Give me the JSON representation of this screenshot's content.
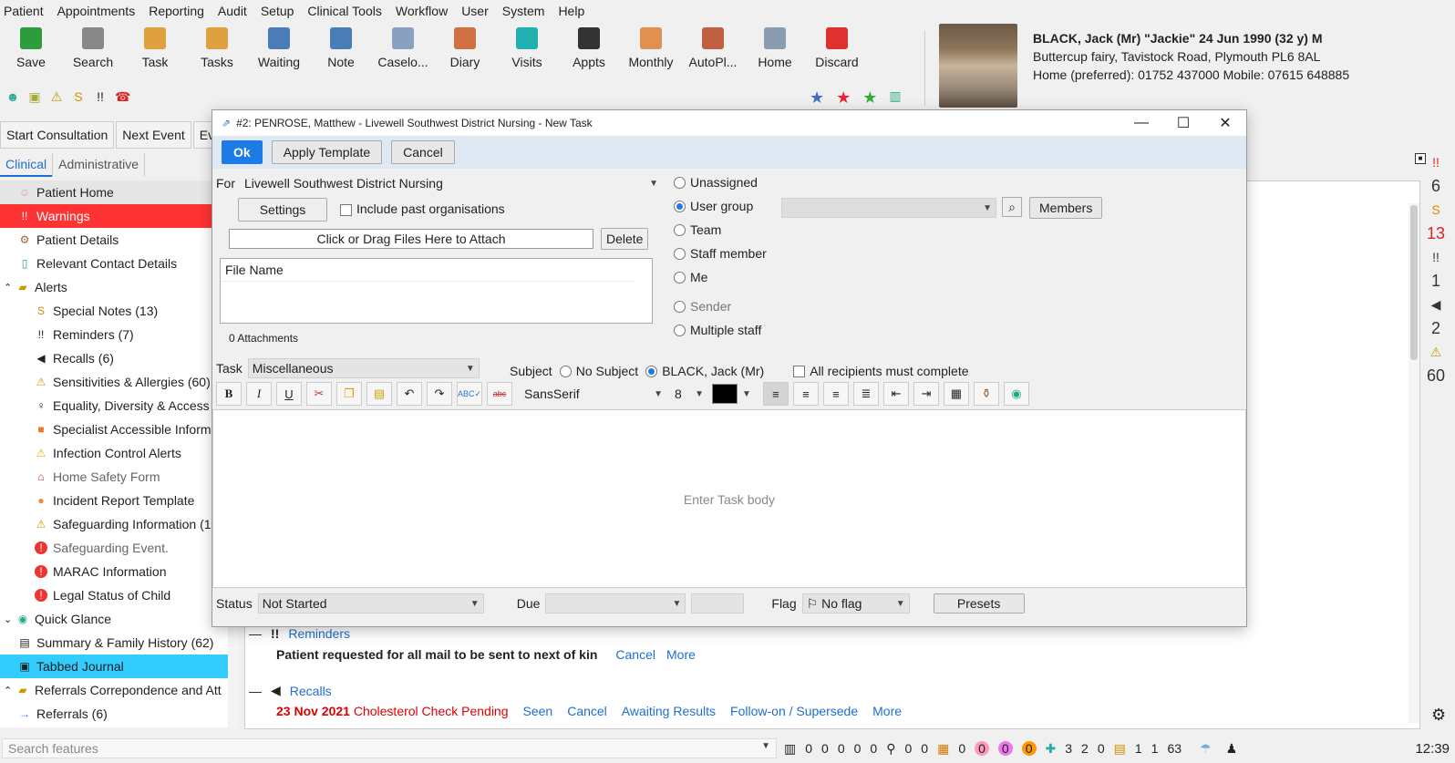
{
  "menu": [
    "Patient",
    "Appointments",
    "Reporting",
    "Audit",
    "Setup",
    "Clinical Tools",
    "Workflow",
    "User",
    "System",
    "Help"
  ],
  "toolbar": [
    {
      "label": "Save",
      "icon": "save-icon",
      "color": "#2e9b3c"
    },
    {
      "label": "Search",
      "icon": "search-icon",
      "color": "#888"
    },
    {
      "label": "Task",
      "icon": "task-icon",
      "color": "#e0a040"
    },
    {
      "label": "Tasks",
      "icon": "tasks-icon",
      "color": "#e0a040"
    },
    {
      "label": "Waiting",
      "icon": "waiting-icon",
      "color": "#4a7db8"
    },
    {
      "label": "Note",
      "icon": "note-icon",
      "color": "#4a7db8"
    },
    {
      "label": "Caselo...",
      "icon": "caseload-icon",
      "color": "#8aa0c0"
    },
    {
      "label": "Diary",
      "icon": "diary-icon",
      "color": "#d07040"
    },
    {
      "label": "Visits",
      "icon": "visits-icon",
      "color": "#20b0b0"
    },
    {
      "label": "Appts",
      "icon": "appts-icon",
      "color": "#333"
    },
    {
      "label": "Monthly",
      "icon": "monthly-icon",
      "color": "#e09050"
    },
    {
      "label": "AutoPl...",
      "icon": "autoplan-icon",
      "color": "#c06040"
    },
    {
      "label": "Home",
      "icon": "home-icon",
      "color": "#8a9cb0"
    },
    {
      "label": "Discard",
      "icon": "discard-icon",
      "color": "#e03030"
    }
  ],
  "patient": {
    "name": "BLACK, Jack (Mr) \"Jackie\" 24 Jun 1990 (32 y) M",
    "address": "Buttercup fairy, Tavistock Road, Plymouth PL6 8AL",
    "phone": "Home (preferred): 01752 437000 Mobile: 07615 648885"
  },
  "consult": [
    "Start Consultation",
    "Next Event",
    "Ev"
  ],
  "tabs": [
    "Clinical",
    "Administrative"
  ],
  "sidebar": [
    {
      "label": "Patient Home",
      "indent": 1,
      "icon": "person-icon",
      "style": "hl"
    },
    {
      "label": "Warnings",
      "indent": 1,
      "icon": "warning-icon",
      "style": "warn"
    },
    {
      "label": "Patient Details",
      "indent": 1,
      "icon": "details-icon",
      "style": ""
    },
    {
      "label": "Relevant Contact Details",
      "indent": 1,
      "icon": "contact-icon",
      "style": ""
    },
    {
      "label": "Alerts",
      "indent": 0,
      "icon": "folder-icon",
      "style": "",
      "toggle": "^"
    },
    {
      "label": "Special Notes (13)",
      "indent": 2,
      "icon": "special-notes-icon",
      "style": ""
    },
    {
      "label": "Reminders (7)",
      "indent": 2,
      "icon": "reminder-icon",
      "style": ""
    },
    {
      "label": "Recalls (6)",
      "indent": 2,
      "icon": "recall-icon",
      "style": ""
    },
    {
      "label": "Sensitivities & Allergies (60)",
      "indent": 2,
      "icon": "allergy-icon",
      "style": ""
    },
    {
      "label": "Equality, Diversity & Access",
      "indent": 2,
      "icon": "equality-icon",
      "style": ""
    },
    {
      "label": "Specialist Accessible Inform",
      "indent": 2,
      "icon": "accessible-icon",
      "style": ""
    },
    {
      "label": "Infection Control Alerts",
      "indent": 2,
      "icon": "infection-icon",
      "style": ""
    },
    {
      "label": "Home Safety Form",
      "indent": 2,
      "icon": "home-safety-icon",
      "style": "grey"
    },
    {
      "label": "Incident Report Template",
      "indent": 2,
      "icon": "incident-icon",
      "style": ""
    },
    {
      "label": "Safeguarding Information (1",
      "indent": 2,
      "icon": "safeguarding-icon",
      "style": ""
    },
    {
      "label": "Safeguarding Event.",
      "indent": 2,
      "icon": "alert-icon",
      "style": "grey"
    },
    {
      "label": "MARAC Information",
      "indent": 2,
      "icon": "alert-icon",
      "style": ""
    },
    {
      "label": "Legal Status of Child",
      "indent": 2,
      "icon": "alert-icon",
      "style": ""
    },
    {
      "label": "Quick Glance",
      "indent": 0,
      "icon": "eye-icon",
      "style": "",
      "toggle": "v"
    },
    {
      "label": "Summary & Family History (62)",
      "indent": 1,
      "icon": "summary-icon",
      "style": ""
    },
    {
      "label": "Tabbed Journal",
      "indent": 1,
      "icon": "journal-icon",
      "style": "sel"
    },
    {
      "label": "Referrals Correpondence and Att",
      "indent": 0,
      "icon": "folder-icon",
      "style": "",
      "toggle": "^"
    },
    {
      "label": "Referrals (6)",
      "indent": 1,
      "icon": "arrow-icon",
      "style": ""
    }
  ],
  "rightcol": [
    "!!",
    "6",
    "S",
    "13",
    "!!",
    "1",
    "◀",
    "2",
    "⚠",
    "60"
  ],
  "dialog": {
    "title": "#2: PENROSE, Matthew - Livewell Southwest District Nursing - New Task",
    "ok": "Ok",
    "apply": "Apply Template",
    "cancel": "Cancel",
    "for_label": "For",
    "for_value": "Livewell Southwest District Nursing",
    "settings": "Settings",
    "include_past": "Include past organisations",
    "attach": "Click or Drag Files Here to Attach",
    "delete": "Delete",
    "file_name": "File Name",
    "attachments": "0 Attachments",
    "radios": [
      "Unassigned",
      "User group",
      "Team",
      "Staff member",
      "Me",
      "Sender",
      "Multiple staff"
    ],
    "members": "Members",
    "task_label": "Task",
    "task_value": "Miscellaneous",
    "subject_label": "Subject",
    "no_subject": "No Subject",
    "subject_patient": "BLACK, Jack (Mr)",
    "all_recipients": "All recipients must complete",
    "font": "SansSerif",
    "size": "8",
    "body_placeholder": "Enter Task body",
    "status_label": "Status",
    "status_value": "Not Started",
    "due_label": "Due",
    "flag_label": "Flag",
    "flag_value": "No flag",
    "presets": "Presets"
  },
  "journal": {
    "reminders_title": "Reminders",
    "reminder_text": "Patient requested for all mail to be sent to next of kin",
    "cancel": "Cancel",
    "more": "More",
    "recalls_title": "Recalls",
    "recall_date": "23 Nov 2021",
    "recall_text": "Cholesterol Check Pending",
    "recall_actions": [
      "Seen",
      "Cancel",
      "Awaiting Results",
      "Follow-on / Supersede",
      "More"
    ]
  },
  "status": {
    "search_placeholder": "Search features",
    "counts": [
      "0",
      "0",
      "0",
      "0",
      "0",
      "0",
      "0",
      "0",
      "0",
      "0",
      "0",
      "3",
      "2",
      "0",
      "1",
      "1",
      "63"
    ],
    "time": "12:39"
  }
}
